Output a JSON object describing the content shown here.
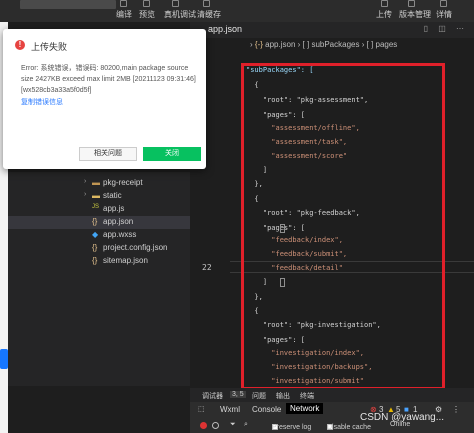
{
  "toolbar": {
    "buttons": [
      "编译",
      "预览",
      "真机调试",
      "清缓存"
    ],
    "right_buttons": [
      "上传",
      "版本管理",
      "详情"
    ]
  },
  "editor": {
    "active_tab": "app.json",
    "breadcrumb": [
      "app.json",
      "[ ] subPackages",
      "[ ] pages"
    ],
    "current_line_number": "22",
    "code": [
      "\"subPackages\": [",
      "  {",
      "    \"root\": \"pkg-assessment\",",
      "    \"pages\": [",
      "      \"assessment/offline\",",
      "      \"assessment/task\",",
      "      \"assessment/score\"",
      "    ]",
      "  },",
      "  {",
      "    \"root\": \"pkg-feedback\",",
      "    \"pages\": [",
      "      \"feedback/index\",",
      "      \"feedback/submit\",",
      "      \"feedback/detail\"",
      "    ]",
      "  },",
      "  {",
      "    \"root\": \"pkg-investigation\",",
      "    \"pages\": [",
      "      \"investigation/index\",",
      "      \"investigation/backups\",",
      "      \"investigation/submit\""
    ]
  },
  "file_tree": [
    {
      "name": "pkg-receipt",
      "type": "folder"
    },
    {
      "name": "static",
      "type": "folder"
    },
    {
      "name": "app.js",
      "type": "js"
    },
    {
      "name": "app.json",
      "type": "json",
      "selected": true
    },
    {
      "name": "app.wxss",
      "type": "wxss"
    },
    {
      "name": "project.config.json",
      "type": "json"
    },
    {
      "name": "sitemap.json",
      "type": "json"
    }
  ],
  "dialog": {
    "title": "上传失败",
    "message": "Error: 系统错误，错误码: 80200,main package source size 2427KB exceed max limit 2MB [20211123 09:31:46][wx528cb3a33a5f0d5f]",
    "copy_link": "复制错误信息",
    "help_button": "相关问题",
    "close_button": "关闭"
  },
  "devtools": {
    "header_items": [
      "调试器",
      "3, 5",
      "问题",
      "输出",
      "终端"
    ],
    "tabs": [
      "Wxml",
      "Console",
      "Network"
    ],
    "active_tab": "Network",
    "filter": {
      "preserve_log": "Preserve log",
      "disable_cache": "Disable cache",
      "throttling": "Online"
    },
    "counts": {
      "errors": "3",
      "warnings": "5",
      "info": "1"
    }
  },
  "watermark": "CSDN @yawang...",
  "colors": {
    "highlight_box": "#e0202a",
    "primary_button": "#07c160",
    "link": "#2979ff"
  }
}
